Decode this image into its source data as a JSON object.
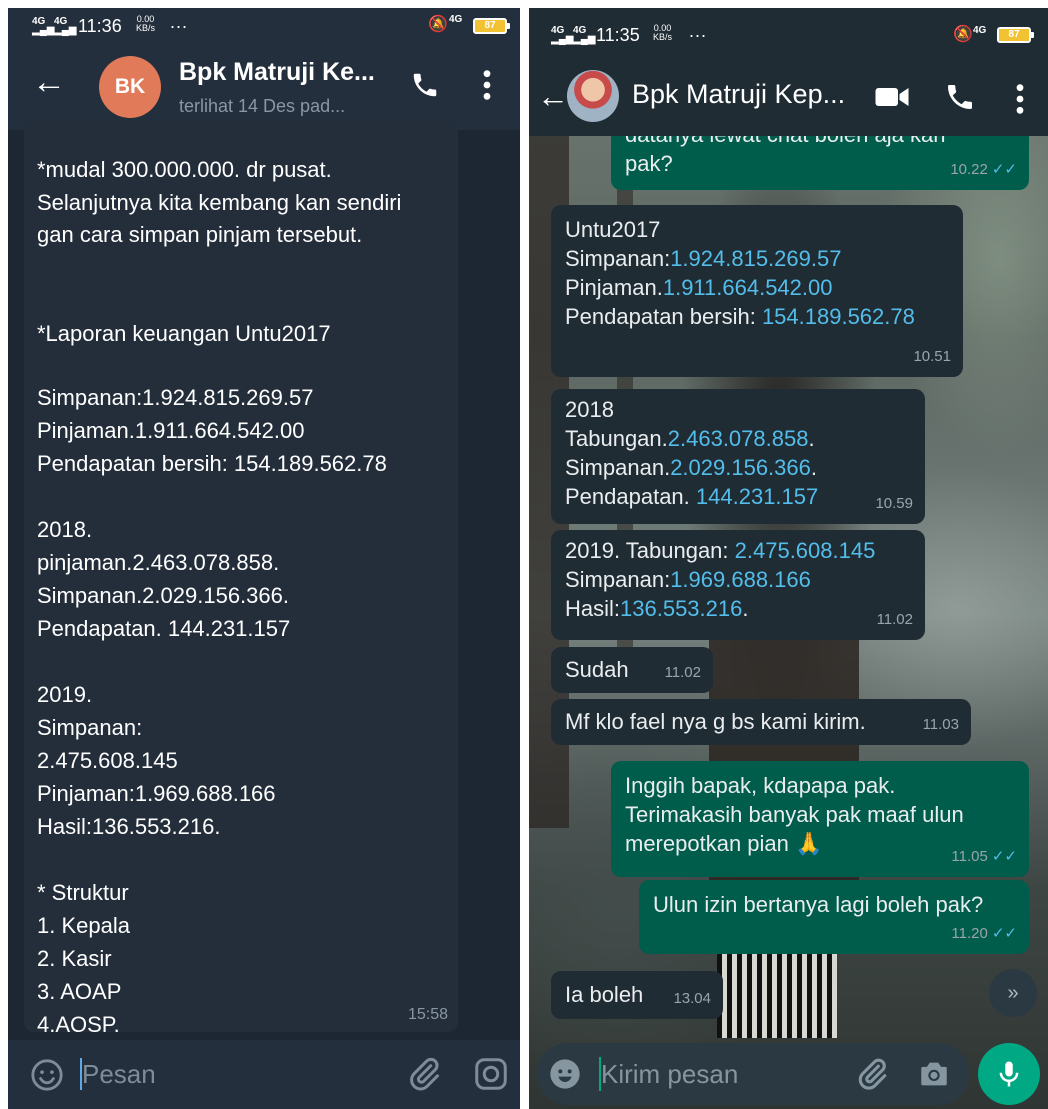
{
  "left": {
    "status": {
      "signal1": "4G",
      "signal2": "4G",
      "time": "11:36",
      "net_speed": "0.00",
      "net_unit": "KB/s",
      "more": "...",
      "net_type": "4G",
      "battery": "87"
    },
    "header": {
      "avatar_initials": "BK",
      "name": "Bpk Matruji Ke...",
      "status": "terlihat 14 Des pad..."
    },
    "message": {
      "lines": [
        "*mudal 300.000.000. dr pusat.",
        "Selanjutnya kita kembang kan sendiri",
        "gan cara simpan pinjam tersebut.",
        "*Laporan keuangan Untu2017",
        "Simpanan:1.924.815.269.57",
        "Pinjaman.1.911.664.542.00",
        "Pendapatan bersih: 154.189.562.78",
        "2018.",
        "pinjaman.2.463.078.858.",
        "Simpanan.2.029.156.366.",
        "Pendapatan. 144.231.157",
        "2019.",
        "Simpanan:",
        "2.475.608.145",
        "Pinjaman:1.969.688.166",
        "Hasil:136.553.216.",
        "* Struktur",
        "1. Kepala",
        "2. Kasir",
        "3. AOAP",
        "4.AOSP."
      ],
      "time": "15:58"
    },
    "composer": {
      "placeholder": "Pesan"
    }
  },
  "right": {
    "status": {
      "signal1": "4G",
      "signal2": "4G",
      "time": "11:35",
      "net_speed": "0.00",
      "net_unit": "KB/s",
      "more": "...",
      "net_type": "4G",
      "battery": "87"
    },
    "header": {
      "name": "Bpk Matruji Kep..."
    },
    "messages": {
      "m0": {
        "l1": "datanya lewat chat boleh aja kah",
        "l2": "pak?",
        "time": "10.22",
        "ticks": "✓✓"
      },
      "m1": {
        "l1": "Untu2017",
        "l2a": "Simpanan:",
        "l2b": "1.924.815.269.57",
        "l3a": "Pinjaman.",
        "l3b": "1.911.664.542.00",
        "l4a": "Pendapatan bersih: ",
        "l4b": "154.189.562.78",
        "time": "10.51"
      },
      "m2": {
        "l1": "2018",
        "l2a": "Tabungan.",
        "l2b": "2.463.078.858",
        "l2c": ".",
        "l3a": "Simpanan.",
        "l3b": "2.029.156.366",
        "l3c": ".",
        "l4a": "Pendapatan. ",
        "l4b": "144.231.157",
        "time": "10.59"
      },
      "m3": {
        "l1a": "2019. Tabungan: ",
        "l1b": "2.475.608.145",
        "l2a": "Simpanan:",
        "l2b": "1.969.688.166",
        "l3a": "Hasil:",
        "l3b": "136.553.216",
        "l3c": ".",
        "time": "11.02"
      },
      "m4": {
        "text": "Sudah",
        "time": "11.02"
      },
      "m5": {
        "text": "Mf klo fael nya g bs kami kirim.",
        "time": "11.03"
      },
      "m6": {
        "l1": "Inggih bapak, kdapapa pak.",
        "l2": "Terimakasih banyak pak maaf ulun",
        "l3": "merepotkan pian 🙏",
        "time": "11.05",
        "ticks": "✓✓"
      },
      "m7": {
        "text": "Ulun izin bertanya lagi boleh pak?",
        "time": "11.20",
        "ticks": "✓✓"
      },
      "m8": {
        "text": "Ia boleh",
        "time": "13.04"
      }
    },
    "scroll_down_icon": "»",
    "composer": {
      "placeholder": "Kirim pesan"
    }
  }
}
